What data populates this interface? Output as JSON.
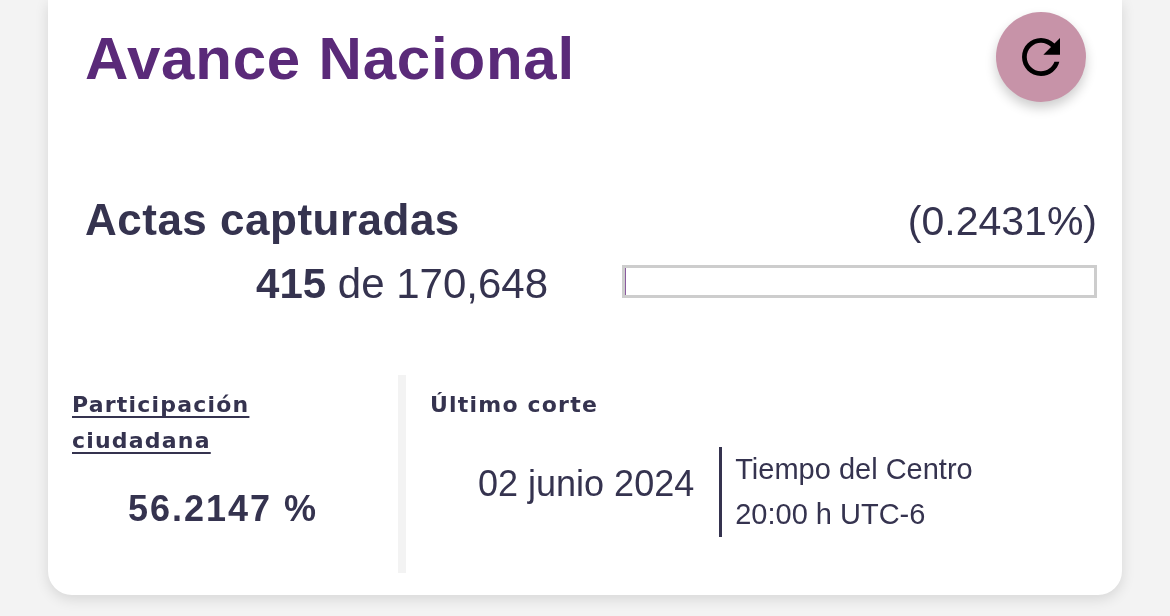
{
  "title": "Avance Nacional",
  "actas": {
    "label": "Actas capturadas",
    "percent": "(0.2431%)",
    "count": "**415** de 170,648",
    "level": 0.002431
  },
  "participacion": {
    "label": "Participación ciudadana",
    "value": "56.2147 %"
  },
  "ultimo_corte": {
    "label": "Último corte",
    "date": "02 junio 2024",
    "timezone": "Tiempo del Centro",
    "time": "20:00 h UTC-6"
  }
}
